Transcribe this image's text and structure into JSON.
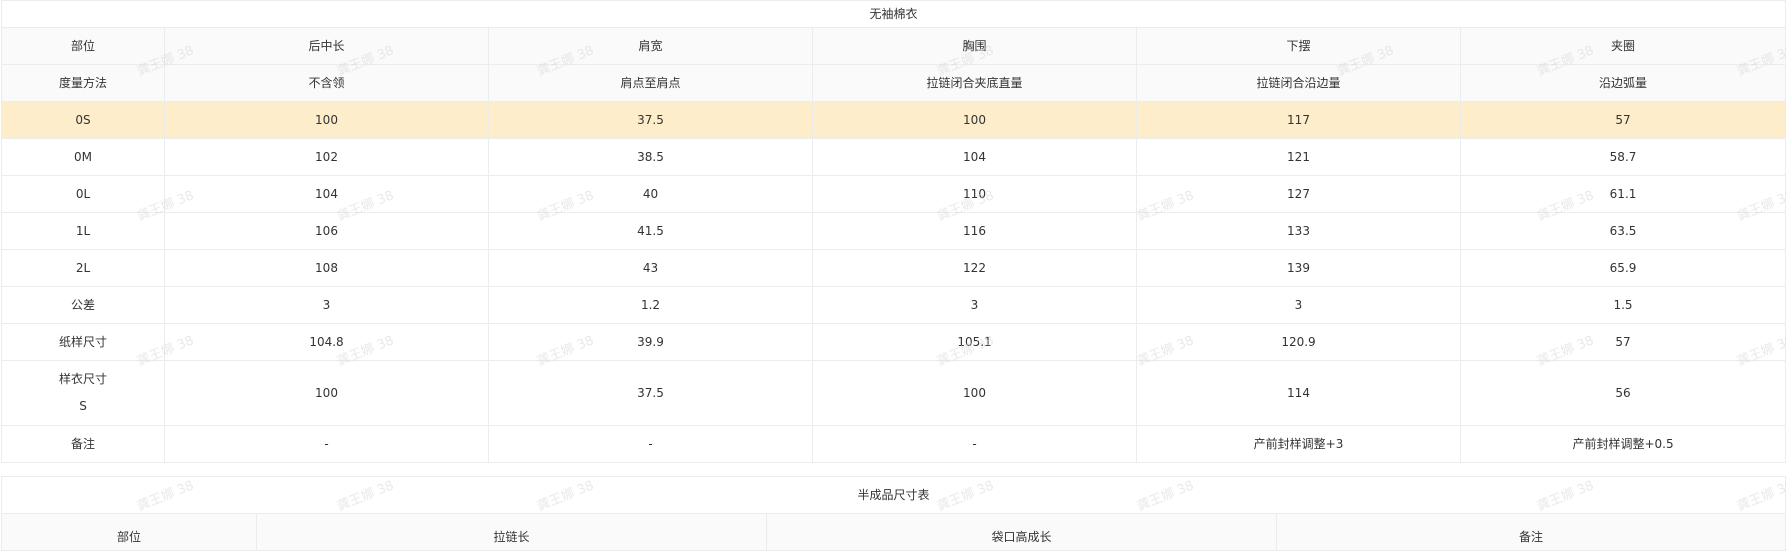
{
  "table1": {
    "title": "无袖棉衣",
    "header": [
      "部位",
      "后中长",
      "肩宽",
      "胸围",
      "下摆",
      "夹圈"
    ],
    "method": [
      "度量方法",
      "不含领",
      "肩点至肩点",
      "拉链闭合夹底直量",
      "拉链闭合沿边量",
      "沿边弧量"
    ],
    "rows": [
      [
        "0S",
        "100",
        "37.5",
        "100",
        "117",
        "57"
      ],
      [
        "0M",
        "102",
        "38.5",
        "104",
        "121",
        "58.7"
      ],
      [
        "0L",
        "104",
        "40",
        "110",
        "127",
        "61.1"
      ],
      [
        "1L",
        "106",
        "41.5",
        "116",
        "133",
        "63.5"
      ],
      [
        "2L",
        "108",
        "43",
        "122",
        "139",
        "65.9"
      ],
      [
        "公差",
        "3",
        "1.2",
        "3",
        "3",
        "1.5"
      ],
      [
        "纸样尺寸",
        "104.8",
        "39.9",
        "105.1",
        "120.9",
        "57"
      ]
    ],
    "sample": {
      "label_line1": "样衣尺寸",
      "label_line2": "S",
      "values": [
        "100",
        "37.5",
        "100",
        "114",
        "56"
      ]
    },
    "notes": [
      "备注",
      "-",
      "-",
      "-",
      "产前封样调整+3",
      "产前封样调整+0.5"
    ]
  },
  "table2": {
    "title": "半成品尺寸表",
    "header": [
      "部位",
      "拉链长",
      "袋口高成长",
      "备注"
    ]
  },
  "watermark": {
    "text": "龚王娜 38",
    "color": "#d8d8d8"
  },
  "colors": {
    "highlight_row": "#fdedcb",
    "header_bg": "#fafafa",
    "border": "#ececec",
    "text": "#333333"
  }
}
